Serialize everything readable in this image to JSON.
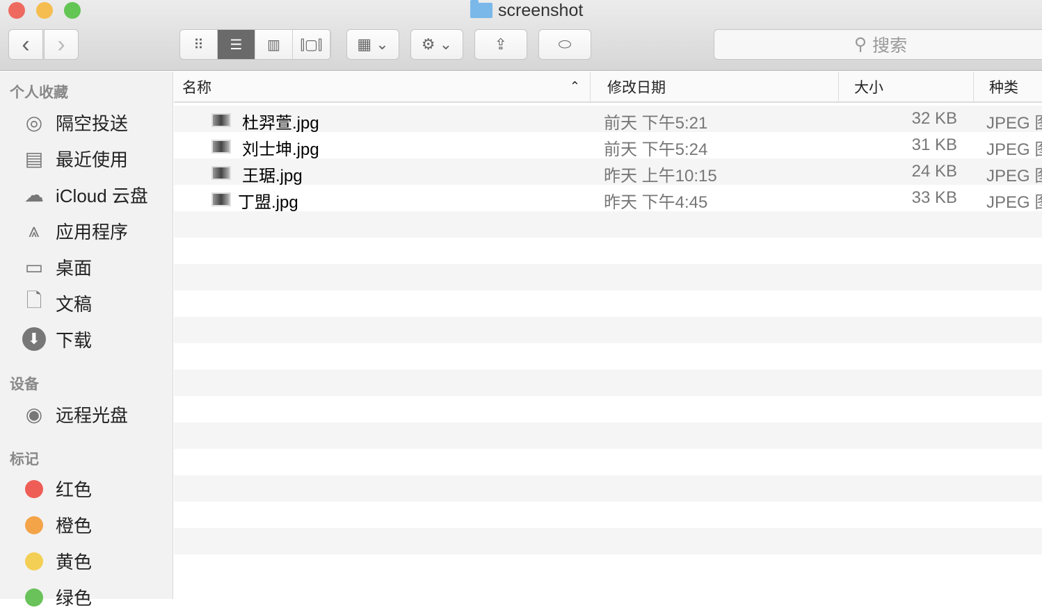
{
  "window": {
    "title": "screenshot",
    "traffic_lights": {
      "close": "#ee6a5f",
      "minimize": "#f5bd4f",
      "zoom": "#62c554"
    }
  },
  "toolbar": {
    "back": "‹",
    "forward": "›",
    "views": [
      "icon-view",
      "list-view",
      "column-view",
      "cover-flow-view"
    ],
    "active_view": "list-view",
    "search_placeholder": "搜索"
  },
  "sidebar": {
    "favorites_title": "个人收藏",
    "favorites": [
      {
        "label": "隔空投送",
        "icon": "airdrop-icon"
      },
      {
        "label": "最近使用",
        "icon": "recents-icon"
      },
      {
        "label": "iCloud 云盘",
        "icon": "cloud-icon"
      },
      {
        "label": "应用程序",
        "icon": "applications-icon"
      },
      {
        "label": "桌面",
        "icon": "desktop-icon"
      },
      {
        "label": "文稿",
        "icon": "documents-icon"
      },
      {
        "label": "下载",
        "icon": "download-icon"
      }
    ],
    "devices_title": "设备",
    "devices": [
      {
        "label": "远程光盘",
        "icon": "disc-icon"
      }
    ],
    "tags_title": "标记",
    "tags": [
      {
        "label": "红色",
        "color": "#ee5e56"
      },
      {
        "label": "橙色",
        "color": "#f4a448"
      },
      {
        "label": "黄色",
        "color": "#f4cf55"
      },
      {
        "label": "绿色",
        "color": "#6ac25a"
      }
    ]
  },
  "columns": {
    "name": "名称",
    "modified": "修改日期",
    "size": "大小",
    "kind": "种类"
  },
  "files": [
    {
      "name": "杜羿萱.jpg",
      "modified": "前天 下午5:21",
      "size": "32 KB",
      "kind": "JPEG 图"
    },
    {
      "name": "刘士坤.jpg",
      "modified": "前天 下午5:24",
      "size": "31 KB",
      "kind": "JPEG 图"
    },
    {
      "name": "王琚.jpg",
      "modified": "昨天 上午10:15",
      "size": "24 KB",
      "kind": "JPEG 图"
    },
    {
      "name": "丁盟.jpg",
      "modified": "昨天 下午4:45",
      "size": "33 KB",
      "kind": "JPEG 图"
    }
  ]
}
